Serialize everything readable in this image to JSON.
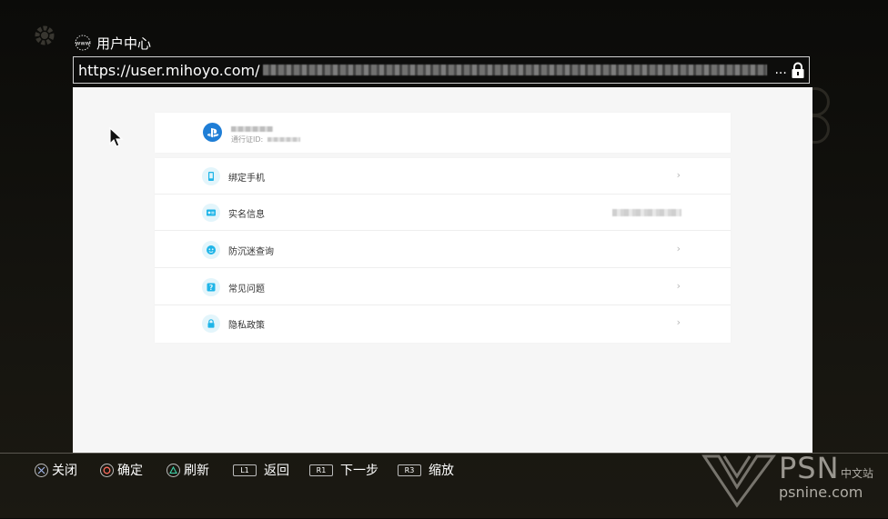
{
  "window": {
    "title": "用户中心",
    "url_visible": "https://user.mihoyo.com/",
    "url_ellipsis": "..."
  },
  "profile": {
    "id_label": "通行证ID:"
  },
  "menu": [
    {
      "label": "绑定手机",
      "icon": "phone-icon",
      "trailing": "chevron"
    },
    {
      "label": "实名信息",
      "icon": "id-card-icon",
      "trailing": "blurred-value"
    },
    {
      "label": "防沉迷查询",
      "icon": "anti-addiction-icon",
      "trailing": "chevron"
    },
    {
      "label": "常见问题",
      "icon": "question-icon",
      "trailing": "chevron"
    },
    {
      "label": "隐私政策",
      "icon": "lock-icon",
      "trailing": "chevron"
    }
  ],
  "bottom_hints": [
    {
      "button": "cross",
      "label": "关闭"
    },
    {
      "button": "circle",
      "label": "确定"
    },
    {
      "button": "triangle",
      "label": "刷新"
    },
    {
      "button": "L1",
      "label": "返回"
    },
    {
      "button": "R1",
      "label": "下一步"
    },
    {
      "button": "R3",
      "label": "缩放"
    }
  ],
  "watermark": {
    "brand": "PSN",
    "cn": "中文站",
    "domain": "psnine.com"
  },
  "colors": {
    "accent": "#1fb5e8",
    "ps_blue": "#1f7ed6",
    "content_bg": "#f6f6f6"
  }
}
